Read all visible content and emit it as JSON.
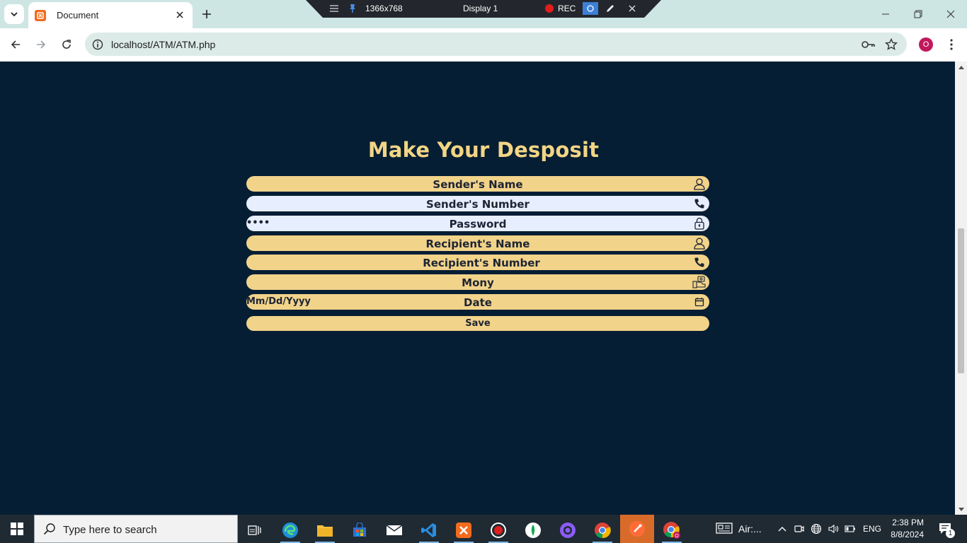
{
  "browser": {
    "tab_title": "Document",
    "url": "localhost/ATM/ATM.php",
    "profile_initial": "O"
  },
  "recorder": {
    "resolution": "1366x768",
    "display": "Display 1",
    "rec_label": "REC"
  },
  "page": {
    "heading": "Make Your Desposit",
    "fields": [
      {
        "label": "Sender's Name",
        "value": "",
        "icon": "user-icon"
      },
      {
        "label": "Sender's Number",
        "value": "",
        "icon": "phone-icon"
      },
      {
        "label": "Password",
        "value": "••••",
        "icon": "lock-icon"
      },
      {
        "label": "Recipient's Name",
        "value": "",
        "icon": "user-icon"
      },
      {
        "label": "Recipient's Number",
        "value": "",
        "icon": "phone-icon"
      },
      {
        "label": "Mony",
        "value": "",
        "icon": "money-icon"
      },
      {
        "label": "Date",
        "value": "Mm/Dd/Yyyy",
        "icon": "calendar-icon"
      }
    ],
    "save_label": "Save"
  },
  "taskbar": {
    "search_placeholder": "Type here to search",
    "weather": "Air:...",
    "language": "ENG",
    "time": "2:38 PM",
    "date": "8/8/2024",
    "notification_count": "1"
  },
  "colors": {
    "page_bg": "#061e33",
    "heading": "#f2d585",
    "field_bg": "#f1d38a",
    "field_autofill_bg": "#e7eefd"
  }
}
